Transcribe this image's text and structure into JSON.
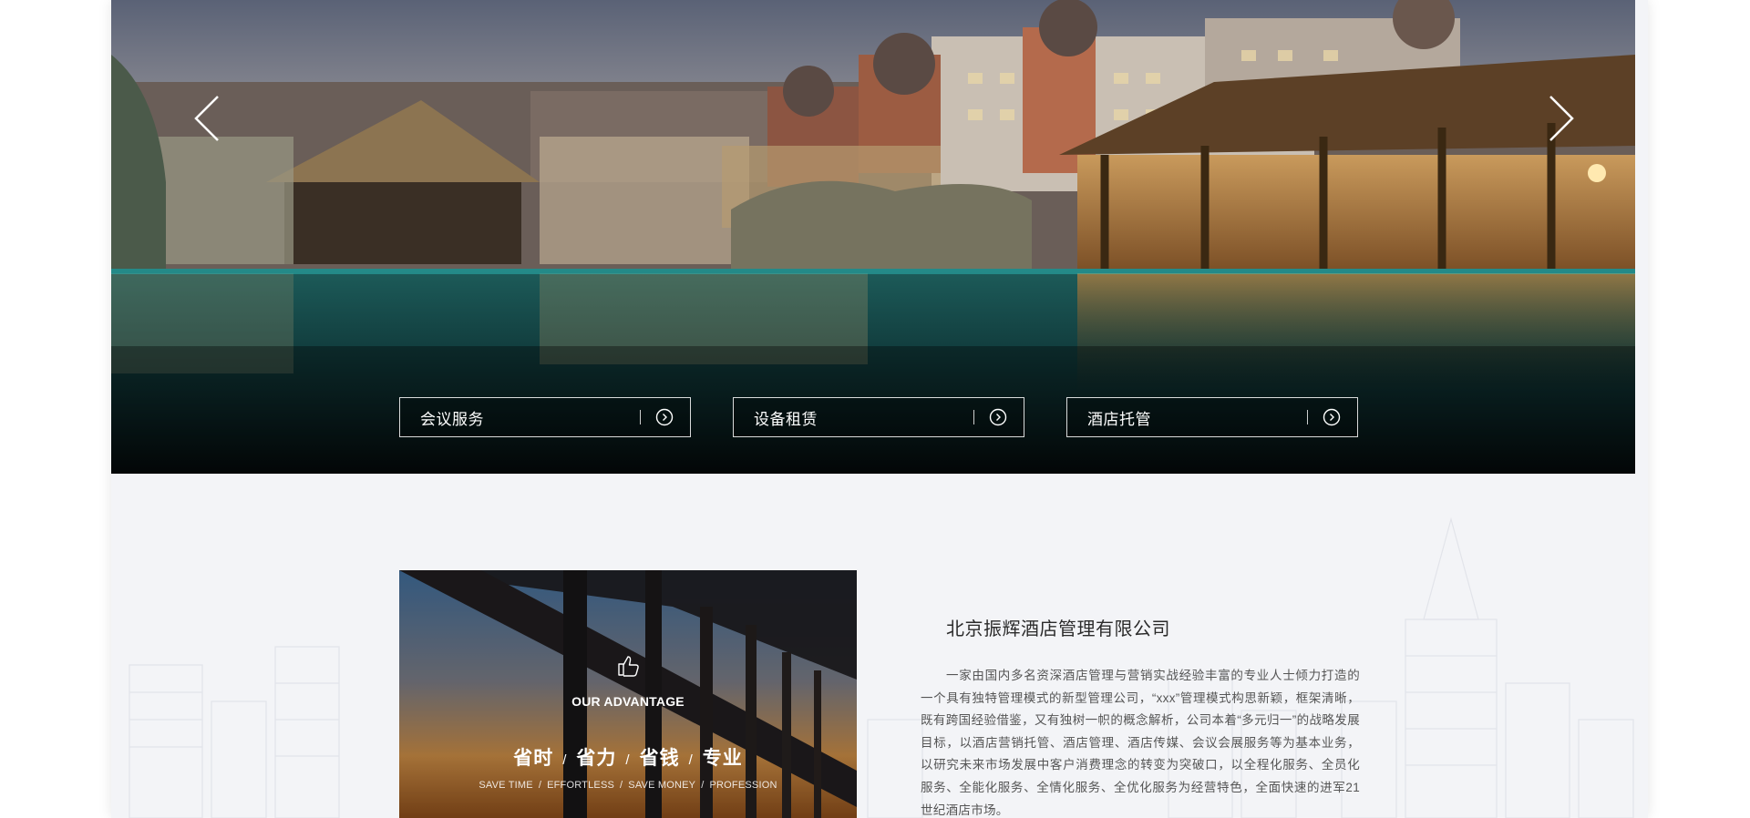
{
  "hero": {
    "prev_icon": "chevron-left-icon",
    "next_icon": "chevron-right-icon",
    "services": [
      {
        "label": "会议服务",
        "icon": "circle-arrow-right-icon"
      },
      {
        "label": "设备租赁",
        "icon": "circle-arrow-right-icon"
      },
      {
        "label": "酒店托管",
        "icon": "circle-arrow-right-icon"
      }
    ]
  },
  "advantage": {
    "icon": "thumbs-up-icon",
    "title": "OUR ADVANTAGE",
    "cn_items": [
      "省时",
      "省力",
      "省钱",
      "专业"
    ],
    "en_items": [
      "SAVE TIME",
      "EFFORTLESS",
      "SAVE MONEY",
      "PROFESSION"
    ],
    "separator": "/"
  },
  "about": {
    "company_name": "北京振辉酒店管理有限公司",
    "intro": "一家由国内多名资深酒店管理与营销实战经验丰富的专业人士倾力打造的一个具有独特管理模式的新型管理公司，“xxx”管理模式构思新颖，框架清晰，既有跨国经验借鉴，又有独树一帜的概念解析，公司本着“多元归一”的战略发展目标，以酒店营销托管、酒店管理、酒店传媒、会议会展服务等为基本业务，以研究未来市场发展中客户消费理念的转变为突破口，以全程化服务、全员化服务、全能化服务、全情化服务、全优化服务为经营特色，全面快速的进军21世纪酒店市场。"
  },
  "colors": {
    "page_bg": "#f3f4f7",
    "text_dark": "#2b2b2b",
    "text_body": "#555555",
    "white": "#ffffff"
  }
}
